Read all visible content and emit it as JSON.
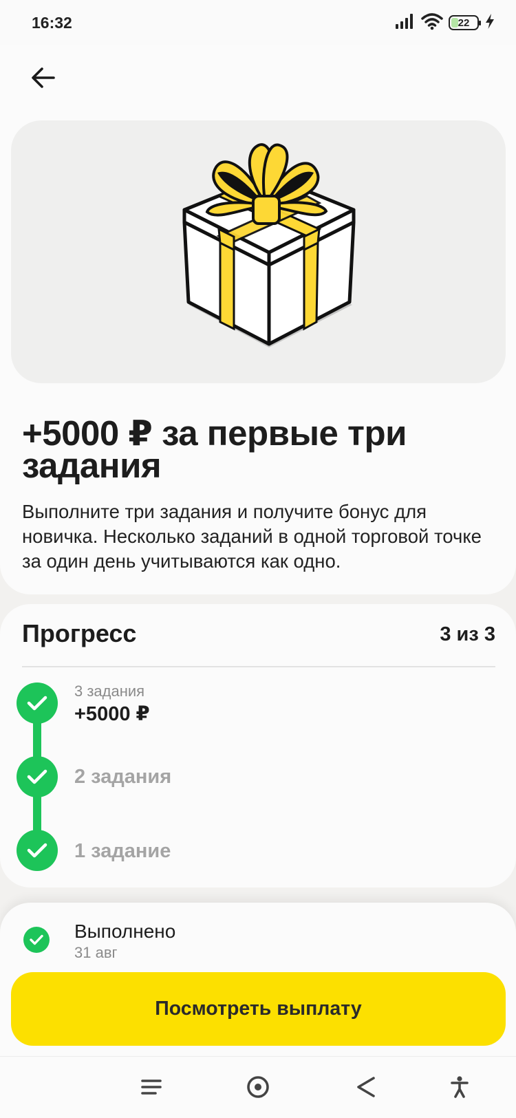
{
  "status_bar": {
    "time": "16:32",
    "battery_level": "22",
    "icons": [
      "signal-icon",
      "wifi-icon",
      "battery-icon",
      "charging-icon"
    ]
  },
  "header": {
    "back_icon": "arrow-left-icon"
  },
  "hero": {
    "image": "gift-box-icon",
    "colors": {
      "ribbon": "#fdd835",
      "outline": "#111111",
      "box": "#ffffff"
    }
  },
  "offer": {
    "title": "+5000 ₽ за первые три задания",
    "description": "Выполните три задания и получите бонус для новичка. Несколько заданий в одной торговой точке за один день учитываются как одно."
  },
  "progress": {
    "title": "Прогресс",
    "count": "3 из 3",
    "steps": [
      {
        "sub": "3 задания",
        "label": "+5000 ₽",
        "done": true
      },
      {
        "label": "2 задания",
        "done": true
      },
      {
        "label": "1 задание",
        "done": true
      }
    ]
  },
  "completion": {
    "label": "Выполнено",
    "date": "31 авг"
  },
  "actions": {
    "payout_label": "Посмотреть выплату"
  },
  "nav": [
    "menu-icon",
    "home-icon",
    "back-triangle-icon",
    "accessibility-icon"
  ],
  "colors": {
    "accent": "#fce000",
    "success": "#1dc459",
    "background": "#f2f1ef",
    "card": "#fbfbfb"
  }
}
